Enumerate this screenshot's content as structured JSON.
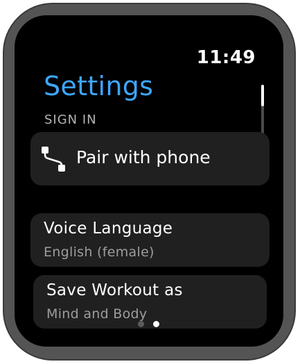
{
  "status_bar": {
    "time": "11:49"
  },
  "header": {
    "title": "Settings",
    "title_color": "#3ea6ff"
  },
  "sections": {
    "sign_in_label": "SIGN IN"
  },
  "items": {
    "pair_phone": {
      "label": "Pair with phone",
      "icon": "pair-phone-icon"
    },
    "voice_language": {
      "title": "Voice Language",
      "value": "English (female)"
    },
    "save_workout": {
      "title": "Save Workout as",
      "value": "Mind and Body"
    }
  },
  "pagination": {
    "pages": 2,
    "current_page": 2
  },
  "scroll": {
    "position": "top"
  }
}
